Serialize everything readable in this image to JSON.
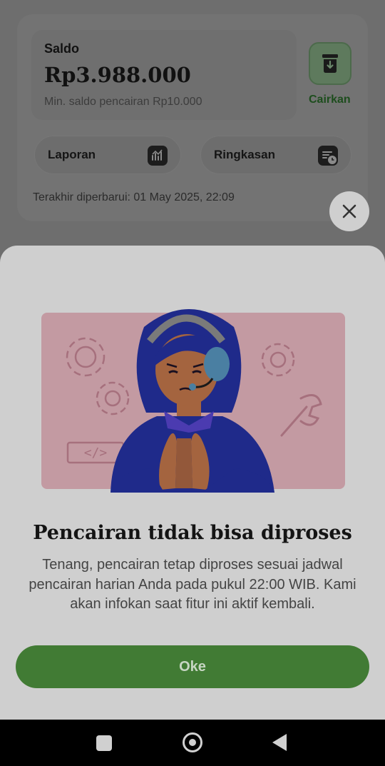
{
  "balance": {
    "label": "Saldo",
    "amount": "Rp3.988.000",
    "min_note": "Min. saldo pencairan Rp10.000",
    "withdraw_label": "Cairkan"
  },
  "actions": {
    "report_label": "Laporan",
    "summary_label": "Ringkasan"
  },
  "last_updated": "Terakhir diperbarui:  01 May 2025, 22:09",
  "dialog": {
    "title": "Pencairan tidak bisa diproses",
    "description": "Tenang, pencairan tetap diproses sesuai jadwal pencairan harian Anda pada pukul 22:00 WIB. Kami akan infokan saat fitur ini aktif kembali.",
    "ok_label": "Oke",
    "illustration_code_text": "</>"
  },
  "colors": {
    "primary_green": "#417b34",
    "sheet_bg": "#cfcfcf",
    "illustration_panel": "#c39aa2",
    "character_navy": "#1f2a8a"
  },
  "icons": [
    "withdraw-icon",
    "chart-icon",
    "summary-icon",
    "close-icon",
    "gear-icon",
    "wrench-icon",
    "nav-recents-icon",
    "nav-home-icon",
    "nav-back-icon"
  ]
}
